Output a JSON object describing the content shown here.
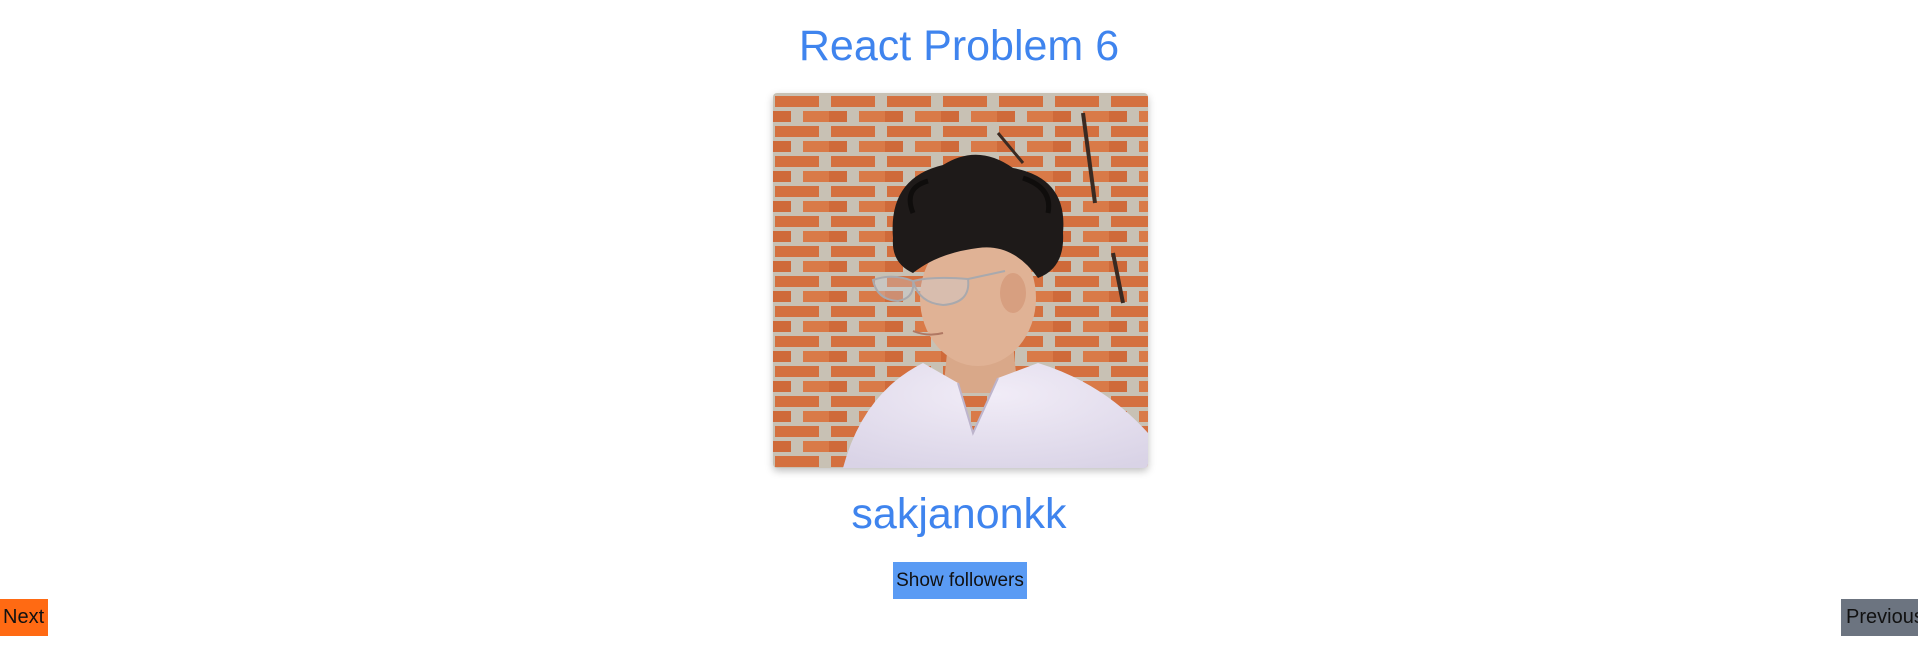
{
  "header": {
    "title": "React Problem 6"
  },
  "profile": {
    "username": "sakjanonkk",
    "avatar_alt": "profile photo"
  },
  "actions": {
    "show_followers_label": "Show followers",
    "next_label": "Next",
    "previous_label": "Previous"
  },
  "colors": {
    "title": "#3f84ee",
    "followers_button": "#5a9bf4",
    "next_button": "#ff6a13",
    "previous_button": "#6c7480"
  }
}
